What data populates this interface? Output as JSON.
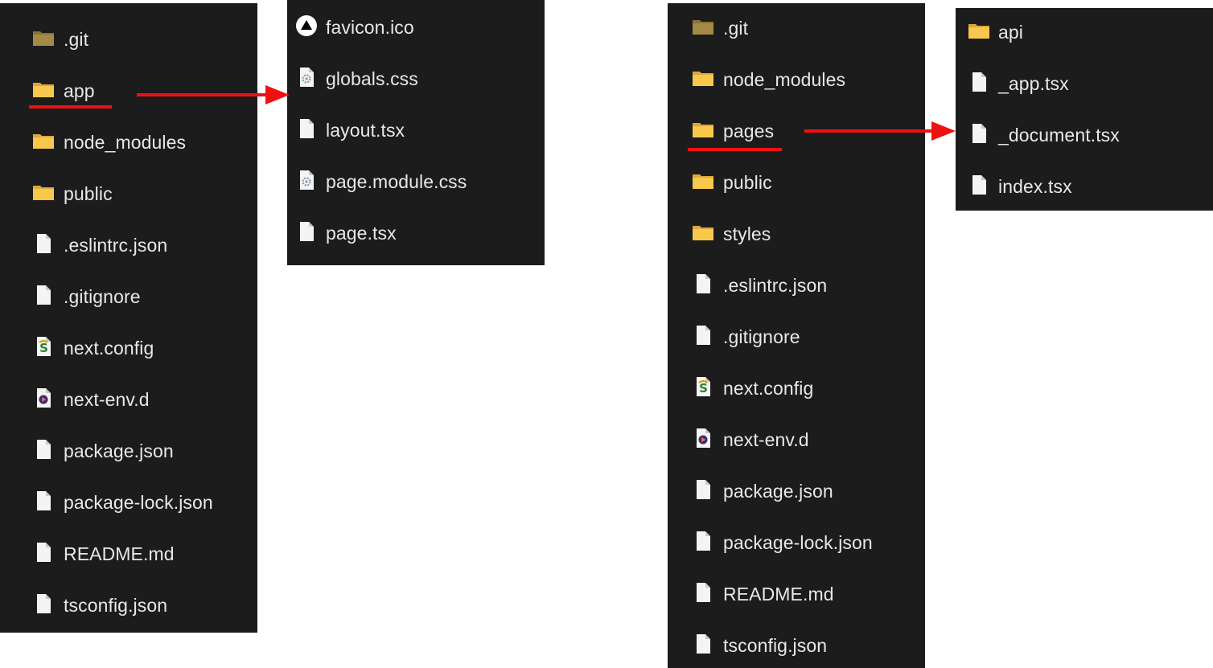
{
  "colors": {
    "panel_bg": "#1c1c1c",
    "text": "#e8e8e8",
    "folder": "#f2c54a",
    "highlight": "#ee1111"
  },
  "panel_a": {
    "items": [
      {
        "label": ".git",
        "icon": "git-folder-icon"
      },
      {
        "label": "app",
        "icon": "folder-icon"
      },
      {
        "label": "node_modules",
        "icon": "folder-icon"
      },
      {
        "label": "public",
        "icon": "folder-icon"
      },
      {
        "label": ".eslintrc.json",
        "icon": "file-icon"
      },
      {
        "label": ".gitignore",
        "icon": "file-icon"
      },
      {
        "label": "next.config",
        "icon": "js-config-icon"
      },
      {
        "label": "next-env.d",
        "icon": "media-file-icon"
      },
      {
        "label": "package.json",
        "icon": "file-icon"
      },
      {
        "label": "package-lock.json",
        "icon": "file-icon"
      },
      {
        "label": "README.md",
        "icon": "file-icon"
      },
      {
        "label": "tsconfig.json",
        "icon": "file-icon"
      }
    ]
  },
  "panel_b": {
    "items": [
      {
        "label": "favicon.ico",
        "icon": "triangle-logo-icon"
      },
      {
        "label": "globals.css",
        "icon": "gear-file-icon"
      },
      {
        "label": "layout.tsx",
        "icon": "file-icon"
      },
      {
        "label": "page.module.css",
        "icon": "gear-file-icon"
      },
      {
        "label": "page.tsx",
        "icon": "file-icon"
      }
    ]
  },
  "panel_c": {
    "items": [
      {
        "label": ".git",
        "icon": "git-folder-icon"
      },
      {
        "label": "node_modules",
        "icon": "folder-icon"
      },
      {
        "label": "pages",
        "icon": "folder-icon"
      },
      {
        "label": "public",
        "icon": "folder-icon"
      },
      {
        "label": "styles",
        "icon": "folder-icon"
      },
      {
        "label": ".eslintrc.json",
        "icon": "file-icon"
      },
      {
        "label": ".gitignore",
        "icon": "file-icon"
      },
      {
        "label": "next.config",
        "icon": "js-config-icon"
      },
      {
        "label": "next-env.d",
        "icon": "media-file-icon"
      },
      {
        "label": "package.json",
        "icon": "file-icon"
      },
      {
        "label": "package-lock.json",
        "icon": "file-icon"
      },
      {
        "label": "README.md",
        "icon": "file-icon"
      },
      {
        "label": "tsconfig.json",
        "icon": "file-icon"
      }
    ]
  },
  "panel_d": {
    "items": [
      {
        "label": "api",
        "icon": "folder-icon"
      },
      {
        "label": "_app.tsx",
        "icon": "file-icon"
      },
      {
        "label": "_document.tsx",
        "icon": "file-icon"
      },
      {
        "label": "index.tsx",
        "icon": "file-icon"
      }
    ]
  }
}
